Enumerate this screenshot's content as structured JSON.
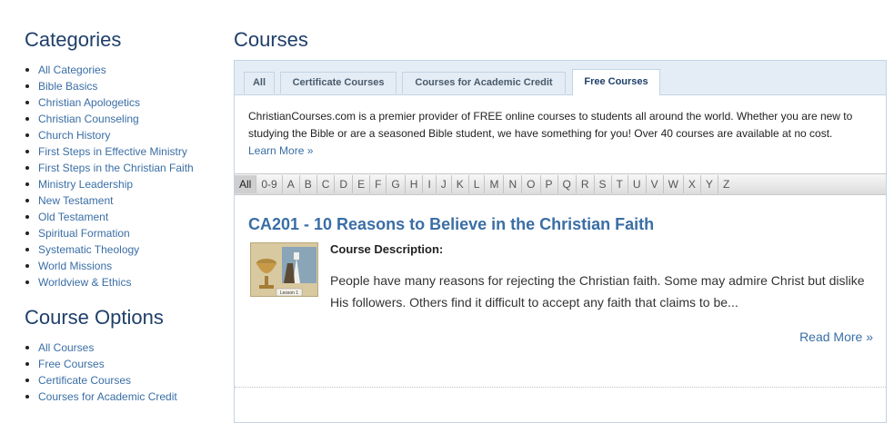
{
  "sidebar": {
    "categories_title": "Categories",
    "categories": [
      "All Categories",
      "Bible Basics",
      "Christian Apologetics",
      "Christian Counseling",
      "Church History",
      "First Steps in Effective Ministry",
      "First Steps in the Christian Faith",
      "Ministry Leadership",
      "New Testament",
      "Old Testament",
      "Spiritual Formation",
      "Systematic Theology",
      "World Missions",
      "Worldview & Ethics"
    ],
    "options_title": "Course Options",
    "options": [
      "All Courses",
      "Free Courses",
      "Certificate Courses",
      "Courses for Academic Credit"
    ]
  },
  "main": {
    "title": "Courses",
    "tabs": [
      "All",
      "Certificate Courses",
      "Courses for Academic Credit",
      "Free Courses"
    ],
    "active_tab": "Free Courses",
    "intro": "ChristianCourses.com is a premier provider of FREE online courses to students all around the world. Whether you are new to studying the Bible or are a seasoned Bible student, we have something for you! Over 40 courses are available at no cost.",
    "learn_more": "Learn More »",
    "alphabet": [
      "All",
      "0-9",
      "A",
      "B",
      "C",
      "D",
      "E",
      "F",
      "G",
      "H",
      "I",
      "J",
      "K",
      "L",
      "M",
      "N",
      "O",
      "P",
      "Q",
      "R",
      "S",
      "T",
      "U",
      "V",
      "W",
      "X",
      "Y",
      "Z"
    ],
    "selected_letter": "All",
    "course": {
      "title": "CA201 - 10 Reasons to Believe in the Christian Faith",
      "desc_label": "Course Description:",
      "desc": "People have many reasons for rejecting the Christian faith. Some may admire Christ but dislike His followers. Others find it difficult to accept any faith that claims to be...",
      "read_more": "Read More »",
      "thumb_label": "Lesson 1"
    }
  }
}
